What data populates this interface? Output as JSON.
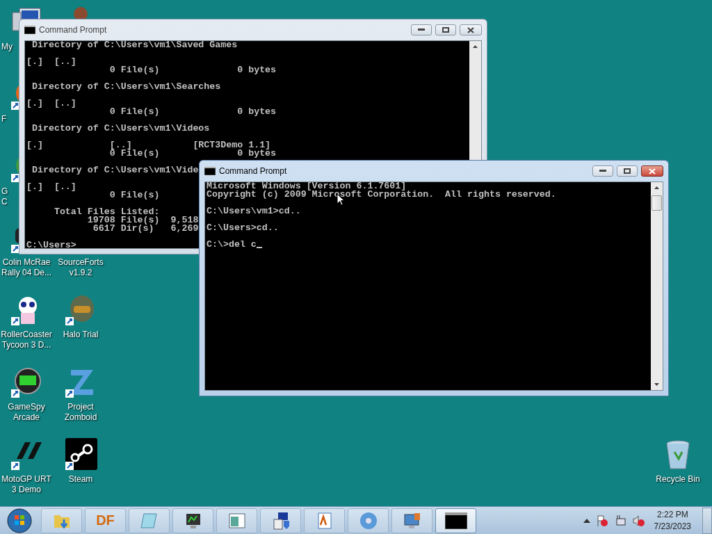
{
  "desktop_icons": [
    {
      "kind": "computer",
      "label": [
        "My"
      ],
      "clipped": true
    },
    {
      "kind": "head"
    },
    {
      "kind": "globe",
      "label": [
        "F"
      ],
      "clipped": true
    },
    {
      "kind": "pie",
      "label": [
        "G",
        "C"
      ],
      "clipped": true
    },
    {
      "kind": "car",
      "label": [
        "Colin McRae",
        "Rally 04 De..."
      ],
      "clipped": false
    },
    {
      "kind": "panda",
      "label": [
        "RollerCoaster",
        "Tycoon 3 D..."
      ],
      "clipped": false
    },
    {
      "kind": "gamespy",
      "label": [
        "GameSpy",
        "Arcade"
      ],
      "clipped": false
    },
    {
      "kind": "motogp",
      "label": [
        "MotoGP URT",
        "3 Demo"
      ],
      "clipped": false
    },
    {
      "kind": "hidden",
      "label": [
        "SourceForts",
        "v1.9.2"
      ],
      "clipped": false
    },
    {
      "kind": "helmet",
      "label": [
        "Halo Trial"
      ],
      "clipped": false
    },
    {
      "kind": "zomboid",
      "label": [
        "Project",
        "Zomboid"
      ],
      "clipped": false
    },
    {
      "kind": "steam",
      "label": [
        "Steam"
      ],
      "clipped": false
    },
    {
      "kind": "recycle",
      "label": [
        "Recycle Bin"
      ],
      "clipped": false
    }
  ],
  "windows": [
    {
      "title": "Command Prompt",
      "active": false,
      "cursor": false,
      "blocks": [
        [
          " Directory of C:\\Users\\vm1\\Saved Games"
        ],
        [
          "[.]  [..]",
          "               0 File(s)              0 bytes"
        ],
        [
          " Directory of C:\\Users\\vm1\\Searches"
        ],
        [
          "[.]  [..]",
          "               0 File(s)              0 bytes"
        ],
        [
          " Directory of C:\\Users\\vm1\\Videos"
        ],
        [
          "[.]            [..]           [RCT3Demo 1.1]",
          "               0 File(s)              0 bytes"
        ],
        [
          " Directory of C:\\Users\\vm1\\Vide"
        ],
        [
          "[.]  [..]",
          "               0 File(s)"
        ],
        [
          "     Total Files Listed:",
          "           19708 File(s)  9,518",
          "            6617 Dir(s)   6,269"
        ],
        [
          "C:\\Users>"
        ]
      ]
    },
    {
      "title": "Command Prompt",
      "active": true,
      "cursor": true,
      "blocks": [
        [
          "Microsoft Windows [Version 6.1.7601]",
          "Copyright (c) 2009 Microsoft Corporation.  All rights reserved."
        ],
        [
          "C:\\Users\\vm1>cd.."
        ],
        [
          "C:\\Users>cd.."
        ],
        [
          "C:\\>del c"
        ]
      ]
    }
  ],
  "taskbar": {
    "buttons": [
      {
        "kind": "folder",
        "selected": false
      },
      {
        "kind": "text",
        "label": "DF",
        "selected": false
      },
      {
        "kind": "notepad",
        "selected": false
      },
      {
        "kind": "monitor",
        "selected": false
      },
      {
        "kind": "window",
        "selected": false
      },
      {
        "kind": "installer",
        "selected": false
      },
      {
        "kind": "wordpad",
        "selected": false
      },
      {
        "kind": "disc",
        "selected": false
      },
      {
        "kind": "remote",
        "selected": false
      },
      {
        "kind": "console",
        "selected": true
      }
    ],
    "clock": {
      "time": "2:22 PM",
      "date": "7/23/2023"
    }
  }
}
